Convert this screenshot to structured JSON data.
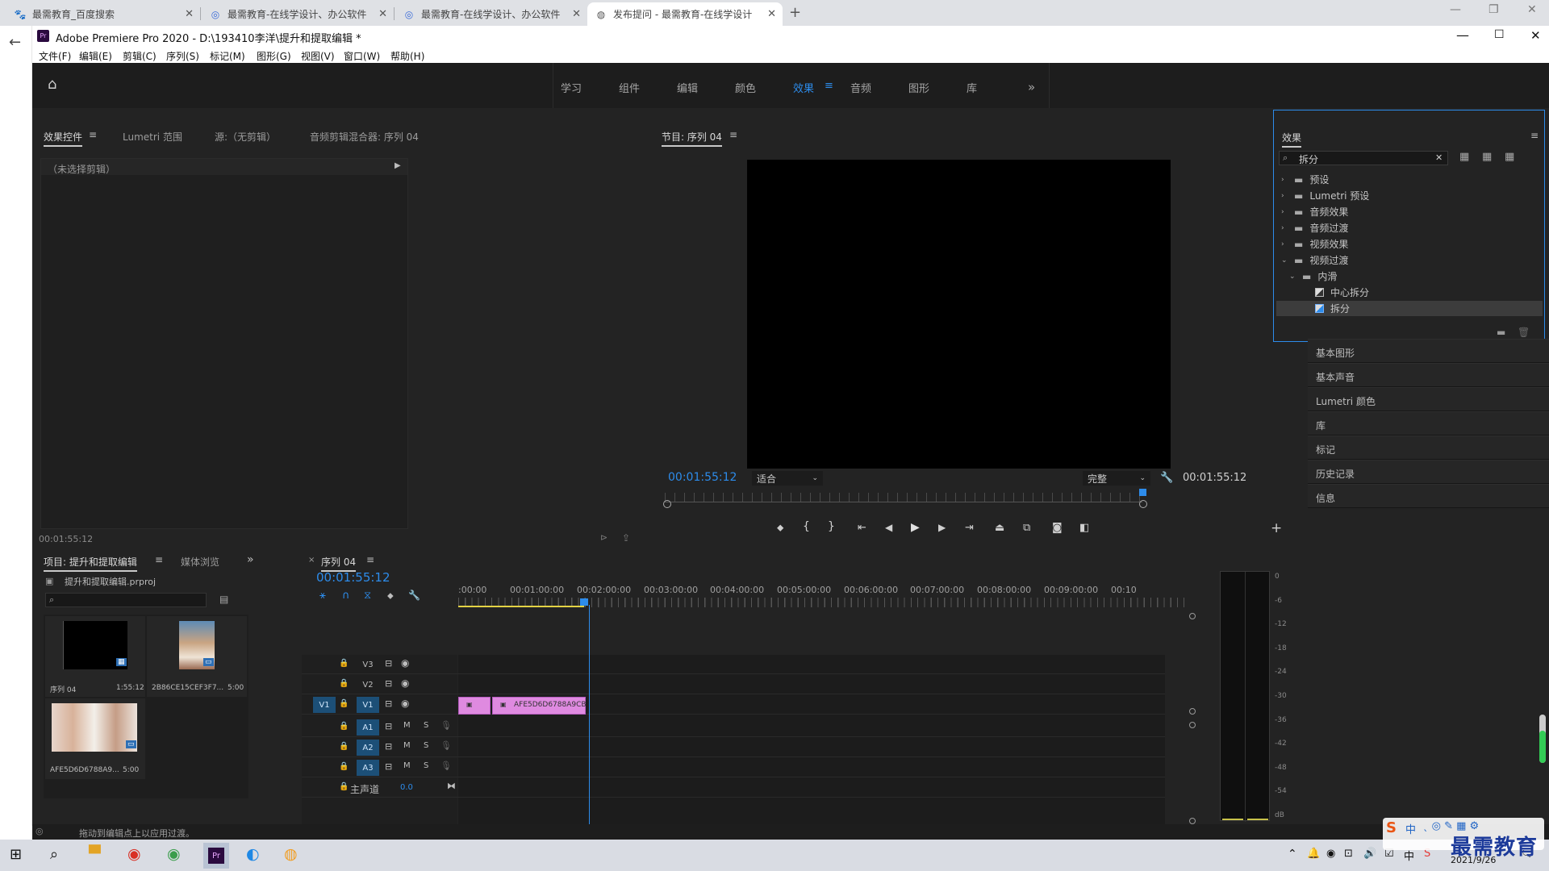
{
  "browser": {
    "tabs": [
      {
        "title": "最需教育_百度搜索"
      },
      {
        "title": "最需教育-在线学设计、办公软件"
      },
      {
        "title": "最需教育-在线学设计、办公软件"
      },
      {
        "title": "发布提问 - 最需教育-在线学设计"
      }
    ]
  },
  "app": {
    "title": "Adobe Premiere Pro 2020 - D:\\193410李洋\\提升和提取编辑 *",
    "menu": [
      "文件(F)",
      "编辑(E)",
      "剪辑(C)",
      "序列(S)",
      "标记(M)",
      "图形(G)",
      "视图(V)",
      "窗口(W)",
      "帮助(H)"
    ],
    "workspaces": [
      "学习",
      "组件",
      "编辑",
      "颜色",
      "效果",
      "音频",
      "图形",
      "库"
    ],
    "active_workspace": "效果",
    "accent": "#2d8ceb"
  },
  "source_panel": {
    "tabs": [
      "效果控件",
      "Lumetri 范围",
      "源:（无剪辑）",
      "音频剪辑混合器: 序列 04"
    ],
    "no_clip": "（未选择剪辑）",
    "timecode": "00:01:55:12"
  },
  "program": {
    "title": "节目: 序列 04",
    "timecode_left": "00:01:55:12",
    "timecode_right": "00:01:55:12",
    "fit": "适合",
    "quality": "完整"
  },
  "effects": {
    "title": "效果",
    "search": "拆分",
    "tree": [
      {
        "label": "预设",
        "level": 0,
        "type": "folder"
      },
      {
        "label": "Lumetri 预设",
        "level": 0,
        "type": "folder"
      },
      {
        "label": "音频效果",
        "level": 0,
        "type": "folder"
      },
      {
        "label": "音频过渡",
        "level": 0,
        "type": "folder"
      },
      {
        "label": "视频效果",
        "level": 0,
        "type": "folder"
      },
      {
        "label": "视频过渡",
        "level": 0,
        "type": "folder-open"
      },
      {
        "label": "内滑",
        "level": 1,
        "type": "folder-open"
      },
      {
        "label": "中心拆分",
        "level": 2,
        "type": "effect"
      },
      {
        "label": "拆分",
        "level": 2,
        "type": "effect",
        "selected": true
      }
    ]
  },
  "side_panels": [
    "基本图形",
    "基本声音",
    "Lumetri 颜色",
    "库",
    "标记",
    "历史记录",
    "信息"
  ],
  "project": {
    "tabs": [
      "项目: 提升和提取编辑",
      "媒体浏览"
    ],
    "file": "提升和提取编辑.prproj",
    "items": [
      {
        "name": "序列 04",
        "duration": "1:55:12"
      },
      {
        "name": "2B86CE15CEF3F7...",
        "duration": "5:00"
      },
      {
        "name": "AFE5D6D6788A9...",
        "duration": "5:00"
      }
    ]
  },
  "timeline": {
    "title": "序列 04",
    "timecode": "00:01:55:12",
    "ruler": [
      ":00:00",
      "00:01:00:00",
      "00:02:00:00",
      "00:03:00:00",
      "00:04:00:00",
      "00:05:00:00",
      "00:06:00:00",
      "00:07:00:00",
      "00:08:00:00",
      "00:09:00:00",
      "00:10"
    ],
    "video_tracks": [
      "V3",
      "V2",
      "V1"
    ],
    "audio_tracks": [
      "A1",
      "A2",
      "A3"
    ],
    "source_patch": "V1",
    "master": "主声道",
    "master_val": "0.0",
    "clip_label": "AFE5D6D6788A9CB",
    "mute": "M",
    "solo": "S"
  },
  "meter": {
    "scale": [
      "0",
      "-6",
      "-12",
      "-18",
      "-24",
      "-30",
      "-36",
      "-42",
      "-48",
      "-54",
      "dB"
    ],
    "solo": [
      "S",
      "S"
    ]
  },
  "status": "拖动到编辑点上以应用过渡。",
  "taskbar": {
    "date": "2021/9/26",
    "watermark": "最需教育",
    "ime": "中"
  }
}
